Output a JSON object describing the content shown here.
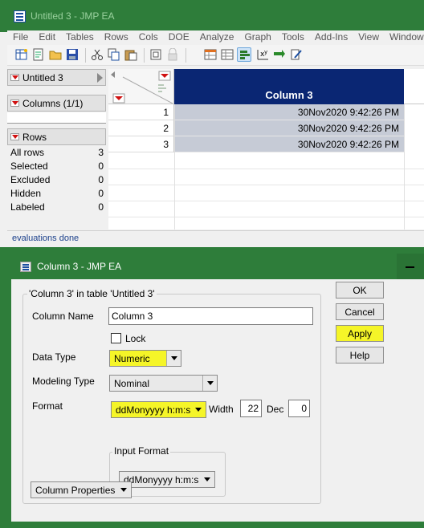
{
  "main_window": {
    "title": "Untitled 3 - JMP EA",
    "menu": [
      "File",
      "Edit",
      "Tables",
      "Rows",
      "Cols",
      "DOE",
      "Analyze",
      "Graph",
      "Tools",
      "Add-Ins",
      "View",
      "Window"
    ],
    "toolbar_icons": [
      "new-data-table-icon",
      "new-script-icon",
      "open-icon",
      "save-icon",
      "cut-icon",
      "copy-icon",
      "paste-icon",
      "journal-icon",
      "lock-icon",
      "data-grid-icon",
      "table-icon",
      "distribution-icon",
      "fit-y-by-x-icon",
      "fit-model-icon",
      "customize-icon"
    ],
    "table_panel": {
      "label": "Untitled 3"
    },
    "columns_panel": {
      "label": "Columns (1/1)"
    },
    "rows_panel": {
      "label": "Rows",
      "stats": [
        {
          "name": "All rows",
          "value": "3"
        },
        {
          "name": "Selected",
          "value": "0"
        },
        {
          "name": "Excluded",
          "value": "0"
        },
        {
          "name": "Hidden",
          "value": "0"
        },
        {
          "name": "Labeled",
          "value": "0"
        }
      ]
    },
    "grid": {
      "column_header": "Column 3",
      "rows": [
        {
          "num": "1",
          "value": "30Nov2020 9:42:26 PM"
        },
        {
          "num": "2",
          "value": "30Nov2020 9:42:26 PM"
        },
        {
          "num": "3",
          "value": "30Nov2020 9:42:26 PM"
        }
      ]
    },
    "status": "evaluations done",
    "colors": {
      "title_bg": "#2e7d3a",
      "column_header_bg": "#0a2673",
      "selected_cell": "#c6cbd6",
      "highlight": "#f5f528"
    }
  },
  "dialog": {
    "title": "Column 3 - JMP EA",
    "group_title": "'Column 3' in table 'Untitled 3'",
    "column_name_label": "Column Name",
    "column_name_value": "Column 3",
    "lock_label": "Lock",
    "data_type_label": "Data Type",
    "data_type_value": "Numeric",
    "modeling_type_label": "Modeling Type",
    "modeling_type_value": "Nominal",
    "format_label": "Format",
    "format_value": "ddMonyyyy h:m:s",
    "width_label": "Width",
    "width_value": "22",
    "dec_label": "Dec",
    "dec_value": "0",
    "input_format_label": "Input Format",
    "input_format_value": "ddMonyyyy h:m:s",
    "column_properties_label": "Column Properties",
    "buttons": {
      "ok": "OK",
      "cancel": "Cancel",
      "apply": "Apply",
      "help": "Help"
    }
  }
}
